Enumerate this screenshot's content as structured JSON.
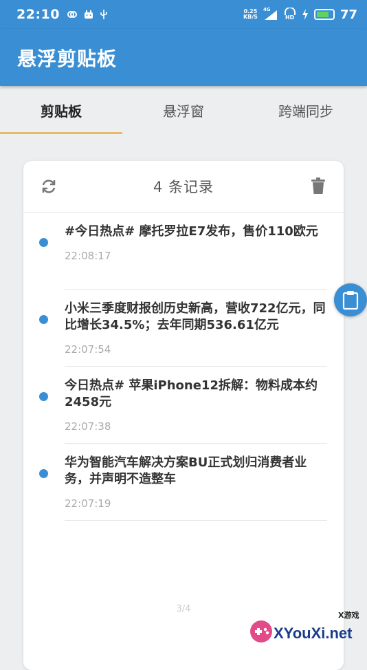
{
  "status": {
    "time": "22:10",
    "net_speed_value": "0.25",
    "net_speed_unit": "KB/S",
    "signal_label": "4G",
    "hd_label": "HD",
    "battery": "77"
  },
  "app": {
    "title": "悬浮剪贴板"
  },
  "tabs": [
    {
      "label": "剪贴板",
      "active": true
    },
    {
      "label": "悬浮窗",
      "active": false
    },
    {
      "label": "跨端同步",
      "active": false
    }
  ],
  "card": {
    "count_label": "4 条记录",
    "items": [
      {
        "text": "#今日热点# 摩托罗拉E7发布，售价110欧元",
        "time": "22:08:17"
      },
      {
        "text": "小米三季度财报创历史新高，营收722亿元，同比增长34.5%；去年同期536.61亿元",
        "time": "22:07:54"
      },
      {
        "text": "今日热点# 苹果iPhone12拆解：物料成本约2458元",
        "time": "22:07:38"
      },
      {
        "text": "华为智能汽车解决方案BU正式划归消费者业务，并声明不造整车",
        "time": "22:07:19"
      }
    ],
    "pager": "3/4"
  },
  "watermark": {
    "small": "X游戏",
    "text": "XYouXi.net"
  },
  "colors": {
    "primary": "#3a8fd4",
    "tab_indicator": "#e8b96a",
    "battery": "#5fd35f"
  },
  "icons": {
    "refresh": "refresh-icon",
    "trash": "trash-icon",
    "clipboard": "clipboard-icon"
  }
}
